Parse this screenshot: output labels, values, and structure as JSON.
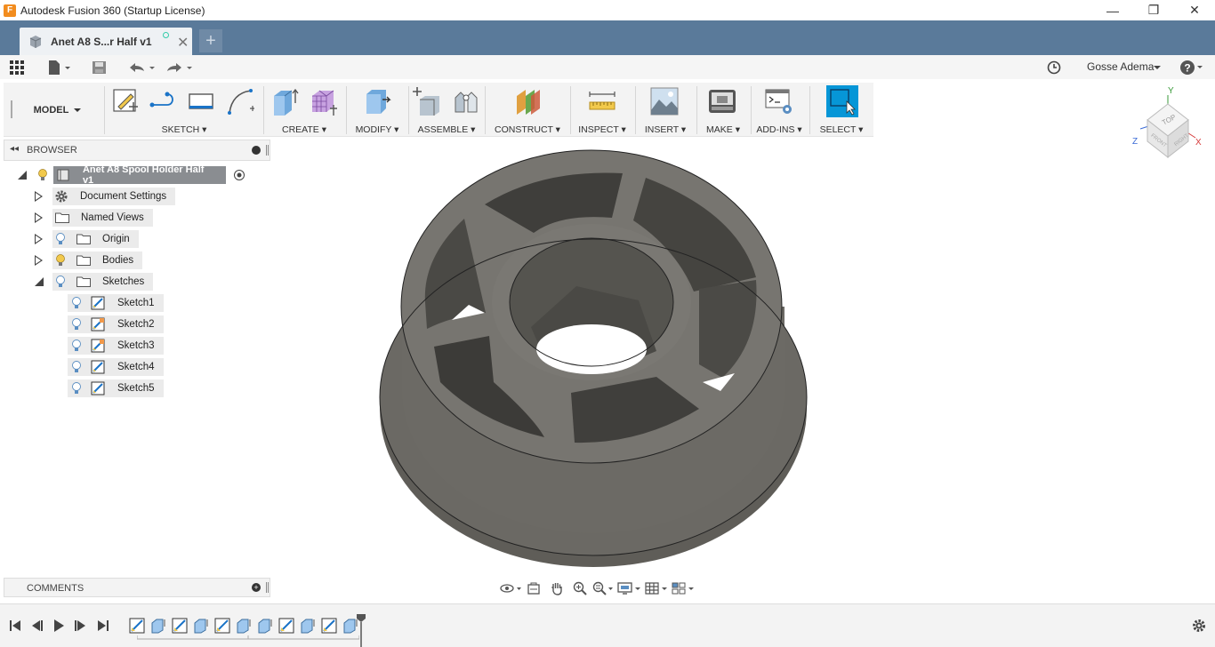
{
  "window": {
    "title": "Autodesk Fusion 360 (Startup License)",
    "app_icon_letter": "F",
    "minimize": "—",
    "maximize": "❐",
    "close": "✕"
  },
  "tabs": [
    {
      "label": "Anet A8 S...r Half v1",
      "close": "✕"
    }
  ],
  "new_tab": "+",
  "quick_access": {
    "user": "Gosse Adema",
    "help": "?"
  },
  "toolbar": {
    "workspace": "MODEL",
    "groups": [
      {
        "label": "SKETCH"
      },
      {
        "label": "CREATE"
      },
      {
        "label": "MODIFY"
      },
      {
        "label": "ASSEMBLE"
      },
      {
        "label": "CONSTRUCT"
      },
      {
        "label": "INSPECT"
      },
      {
        "label": "INSERT"
      },
      {
        "label": "MAKE"
      },
      {
        "label": "ADD-INS"
      },
      {
        "label": "SELECT"
      }
    ]
  },
  "browser": {
    "title": "BROWSER",
    "root": "Anet A8 Spool Holder Half v1",
    "items": [
      {
        "label": "Document Settings"
      },
      {
        "label": "Named Views"
      },
      {
        "label": "Origin"
      },
      {
        "label": "Bodies"
      },
      {
        "label": "Sketches"
      }
    ],
    "sketches": [
      "Sketch1",
      "Sketch2",
      "Sketch3",
      "Sketch4",
      "Sketch5"
    ]
  },
  "comments": {
    "title": "COMMENTS",
    "add": "+"
  },
  "viewcube": {
    "top": "TOP",
    "front": "FRONT",
    "right": "RIGHT",
    "x": "X",
    "y": "Y",
    "z": "Z"
  },
  "colors": {
    "accent": "#0696d7",
    "tabbar": "#5a7a9a",
    "model": "#6b6a66"
  }
}
